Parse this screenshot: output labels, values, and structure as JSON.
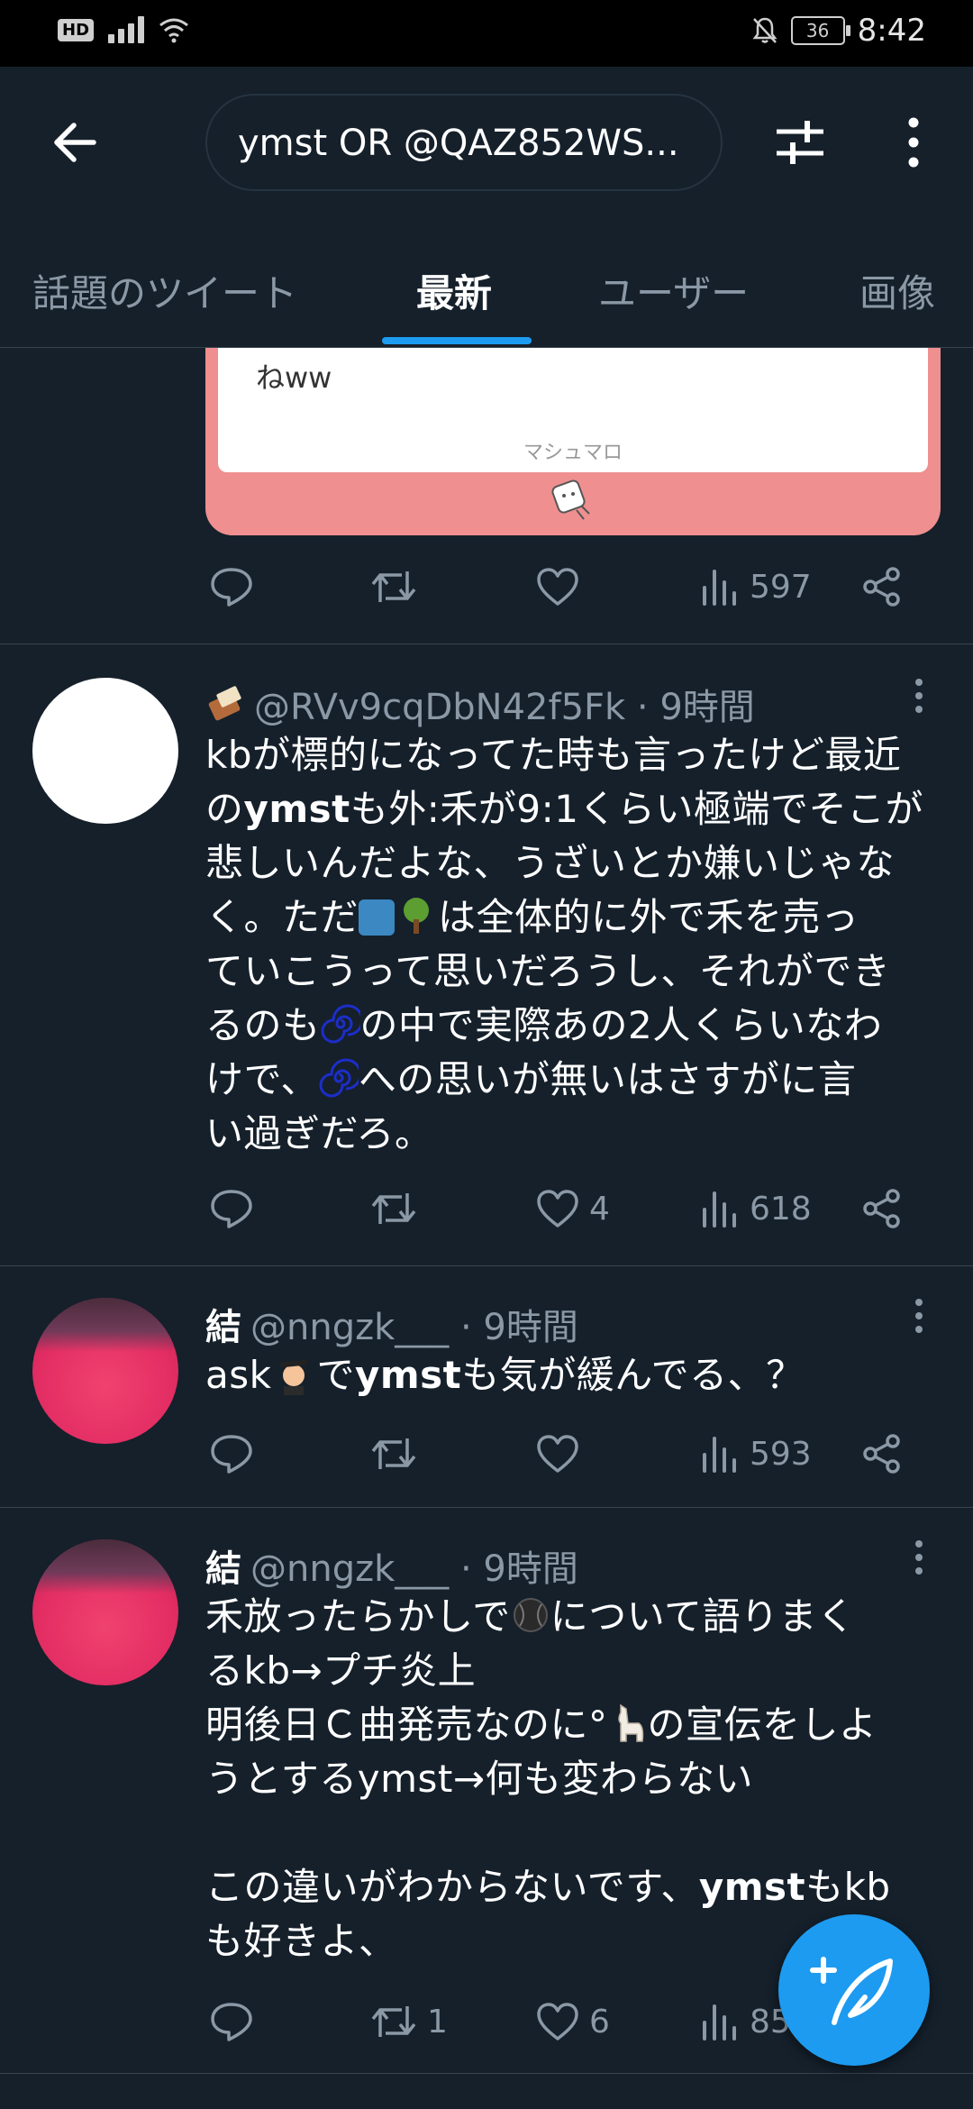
{
  "status_bar": {
    "hd_label": "HD",
    "battery": "36",
    "time": "8:42"
  },
  "search": {
    "query": "ymst OR @QAZ852WS..."
  },
  "tabs": [
    {
      "label": "話題のツイート"
    },
    {
      "label": "最新"
    },
    {
      "label": "ユーザー"
    },
    {
      "label": "画像"
    }
  ],
  "quoted_card": {
    "text": "ねww",
    "brand": "マシュマロ"
  },
  "tweet0": {
    "views": "597"
  },
  "tweet1": {
    "handle_time": "@RVv9cqDbN42f5Fk · 9時間",
    "line1": "kbが標的になってた時も言ったけど最近",
    "line2_a": "の",
    "line2_b": "ymst",
    "line2_c": "も外:禾が9:1くらい極端でそこが",
    "line3": "悲しいんだよな、うざいとか嫌いじゃな",
    "line4_a": "く。ただ",
    "line4_b": "は全体的に外で禾を売っ",
    "line5": "ていこうって思いだろうし、それができ",
    "line6_a": "るのも",
    "line6_b": "の中で実際あの2人くらいなわ",
    "line7_a": "けで、",
    "line7_b": "への思いが無いはさすがに言",
    "line8": "い過ぎだろ。",
    "likes": "4",
    "views": "618"
  },
  "tweet2": {
    "name": "結",
    "handle_time": "@nngzk___ · 9時間",
    "text_a": "ask",
    "text_b": "で",
    "text_c": "ymst",
    "text_d": "も気が緩んでる、？",
    "views": "593"
  },
  "tweet3": {
    "name": "結",
    "handle_time": "@nngzk___ · 9時間",
    "line1_a": "禾放ったらかしで",
    "line1_b": "について語りまく",
    "line2": "るkb→プチ炎上",
    "line3_a": "明後日Ｃ曲発売なのに°",
    "line3_b": "の宣伝をしよ",
    "line4": "うとするymst→何も変わらない",
    "line5_a": "この違いがわからないです、",
    "line5_b": "ymst",
    "line5_c": "もkb",
    "line6": "も好きよ、",
    "retweets": "1",
    "likes": "6",
    "views": "85"
  }
}
